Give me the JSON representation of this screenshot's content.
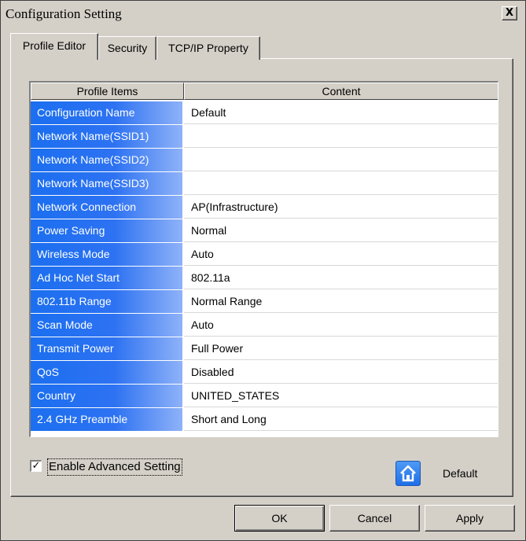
{
  "window": {
    "title": "Configuration Setting",
    "close_label": "X"
  },
  "tabs": [
    {
      "label": "Profile Editor",
      "active": true
    },
    {
      "label": "Security",
      "active": false
    },
    {
      "label": "TCP/IP Property",
      "active": false
    }
  ],
  "grid": {
    "headers": [
      "Profile Items",
      "Content"
    ],
    "rows": [
      {
        "item": "Configuration Name",
        "value": "Default"
      },
      {
        "item": "Network Name(SSID1)",
        "value": ""
      },
      {
        "item": "Network Name(SSID2)",
        "value": ""
      },
      {
        "item": "Network Name(SSID3)",
        "value": ""
      },
      {
        "item": "Network Connection",
        "value": "AP(Infrastructure)"
      },
      {
        "item": "Power Saving",
        "value": "Normal"
      },
      {
        "item": "Wireless Mode",
        "value": "Auto"
      },
      {
        "item": "Ad Hoc Net Start",
        "value": "802.11a"
      },
      {
        "item": "802.11b Range",
        "value": "Normal Range"
      },
      {
        "item": "Scan Mode",
        "value": "Auto"
      },
      {
        "item": "Transmit Power",
        "value": "Full Power"
      },
      {
        "item": "QoS",
        "value": "Disabled"
      },
      {
        "item": "Country",
        "value": "UNITED_STATES"
      },
      {
        "item": "2.4 GHz Preamble",
        "value": "Short and Long"
      }
    ]
  },
  "advanced": {
    "checkbox_label": "Enable Advanced Setting",
    "checked": true,
    "check_mark": "✓"
  },
  "default_control": {
    "icon": "home-icon",
    "label": "Default"
  },
  "buttons": {
    "ok": "OK",
    "cancel": "Cancel",
    "apply": "Apply"
  },
  "colors": {
    "window_bg": "#d4d0c8",
    "item_gradient_start": "#1b6ff0",
    "item_gradient_end": "#8fb2f8"
  }
}
